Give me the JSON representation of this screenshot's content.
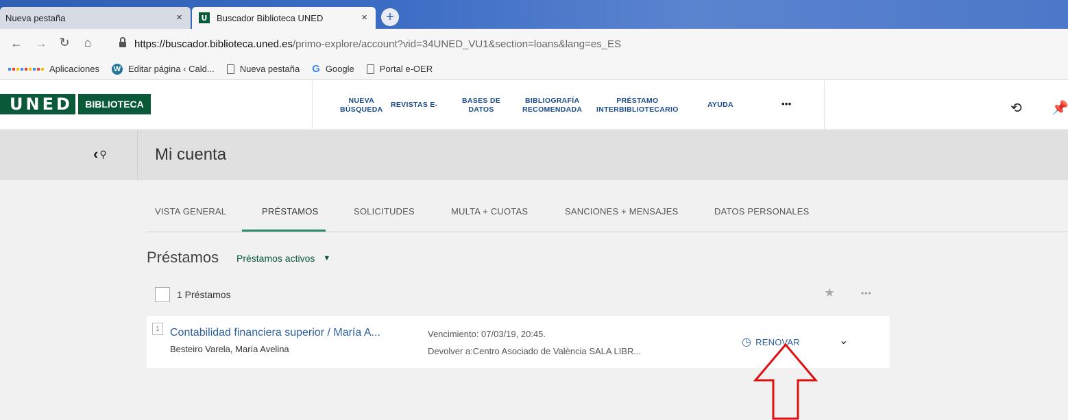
{
  "browser": {
    "tabs": [
      {
        "title": "Nueva pestaña",
        "active": false
      },
      {
        "title": "Buscador Biblioteca UNED",
        "active": true
      }
    ],
    "favicon_letter": "U",
    "close_glyph": "×",
    "newtab_glyph": "+",
    "url_host": "https://buscador.biblioteca.uned.es",
    "url_path": "/primo-explore/account?vid=34UNED_VU1&section=loans&lang=es_ES",
    "bookmarks": [
      "Aplicaciones",
      "Editar página ‹ Cald...",
      "Nueva pestaña",
      "Google",
      "Portal e-OER"
    ]
  },
  "site": {
    "logo_primary": "UNED",
    "logo_secondary": "BIBLIOTECA",
    "nav": {
      "nueva_busqueda": [
        "NUEVA",
        "BÚSQUEDA"
      ],
      "revistas": "REVISTAS E-",
      "bases_datos": [
        "BASES DE",
        "DATOS"
      ],
      "bibliografia": [
        "BIBLIOGRAFÍA",
        "RECOMENDADA"
      ],
      "prestamo_inter": [
        "PRÉSTAMO",
        "INTERBIBLIOTECARIO"
      ],
      "ayuda": "AYUDA",
      "more": "•••"
    },
    "brand_color": "#0a5a3a"
  },
  "account": {
    "page_title": "Mi cuenta",
    "tabs": [
      "VISTA GENERAL",
      "PRÉSTAMOS",
      "SOLICITUDES",
      "MULTA + CUOTAS",
      "SANCIONES + MENSAJES",
      "DATOS PERSONALES"
    ],
    "active_tab": "PRÉSTAMOS",
    "section_title": "Préstamos",
    "filter_label": "Préstamos activos",
    "count_label": "1 Préstamos",
    "more_glyph": "•••"
  },
  "loans": [
    {
      "number": "1",
      "title": "Contabilidad financiera superior / María A...",
      "author": "Besteiro Varela, María Avelina",
      "due": "Vencimiento: 07/03/19, 20:45.",
      "return_to": "Devolver a:Centro Asociado de València SALA LIBR...",
      "renew_label": "RENOVAR"
    }
  ],
  "annotation": {
    "arrow_color": "#e01010"
  }
}
